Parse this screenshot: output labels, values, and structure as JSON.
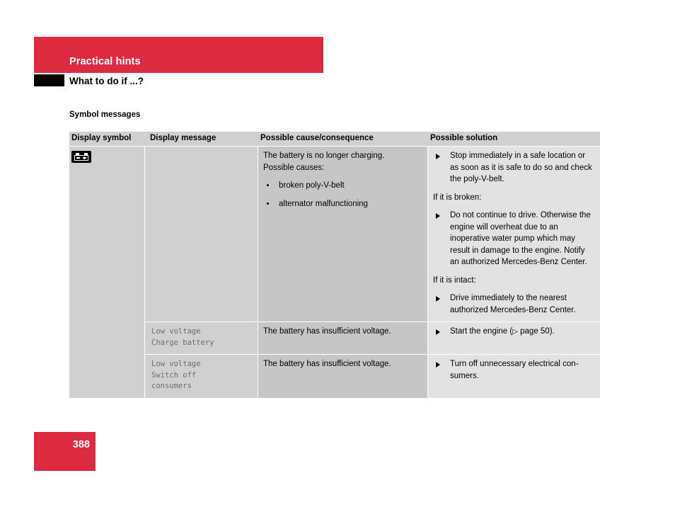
{
  "header": {
    "band_title": "Practical hints",
    "subtitle": "What to do if ...?",
    "band_color": "#DC2A40"
  },
  "section": {
    "label": "Symbol messages"
  },
  "table": {
    "columns": [
      "Display symbol",
      "Display message",
      "Possible cause/consequence",
      "Possible solution"
    ],
    "symbol": {
      "icon": "battery-icon",
      "name": "battery"
    },
    "rows": [
      {
        "display_message": "",
        "cause": {
          "intro_line1": "The battery is no longer charging.",
          "intro_line2": "Possible causes:",
          "bullets": [
            "broken poly-V-belt",
            "alternator malfunctioning"
          ]
        },
        "solution": {
          "blocks": [
            {
              "type": "action",
              "text": "Stop immediately in a safe location or as soon as it is safe to do so and check the poly-V-belt."
            },
            {
              "type": "lead-in",
              "text": "If it is broken:"
            },
            {
              "type": "action",
              "text": "Do not continue to drive. Otherwise the engine will overheat due to an inoperative water pump which may result in damage to the engine. Notify an authorized Mercedes-Benz Center."
            },
            {
              "type": "lead-in",
              "text": "If it is intact:"
            },
            {
              "type": "action",
              "text": "Drive immediately to the nearest authorized Mercedes-Benz Center."
            }
          ]
        }
      },
      {
        "display_message": "Low voltage\nCharge battery",
        "cause": {
          "text": "The battery has insufficient voltage."
        },
        "solution": {
          "blocks": [
            {
              "type": "action-ref",
              "text_before": "Start the engine (",
              "ref_symbol": "▷",
              "text_after": " page 50)."
            }
          ]
        }
      },
      {
        "display_message": "Low voltage\nSwitch off\nconsumers",
        "cause": {
          "text": "The battery has insufficient voltage."
        },
        "solution": {
          "blocks": [
            {
              "type": "action",
              "text": "Turn off unnecessary electrical con-sumers."
            }
          ]
        }
      }
    ]
  },
  "footer": {
    "page_number": "388"
  }
}
